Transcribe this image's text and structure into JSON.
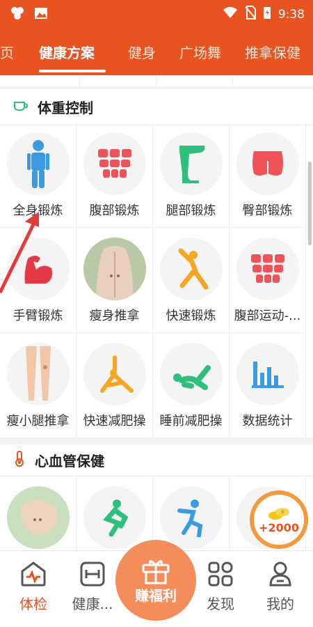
{
  "status_bar": {
    "time": "9:38"
  },
  "tabs": [
    {
      "label": "页",
      "active": false
    },
    {
      "label": "健康方案",
      "active": true
    },
    {
      "label": "健身",
      "active": false
    },
    {
      "label": "广场舞",
      "active": false
    },
    {
      "label": "推拿保健",
      "active": false
    }
  ],
  "weight_section": {
    "title": "体重控制",
    "items": [
      {
        "label": "全身锻炼",
        "icon": "full-body-figure-icon"
      },
      {
        "label": "腹部锻炼",
        "icon": "abs-icon"
      },
      {
        "label": "腿部锻炼",
        "icon": "leg-icon"
      },
      {
        "label": "臀部锻炼",
        "icon": "hip-icon"
      },
      {
        "label": "手臂锻炼",
        "icon": "arm-muscle-icon"
      },
      {
        "label": "瘦身推拿",
        "icon": "back-massage-photo"
      },
      {
        "label": "快速锻炼",
        "icon": "stretch-figure-icon"
      },
      {
        "label": "腹部运动-...",
        "icon": "abs-icon"
      },
      {
        "label": "瘦小腿推拿",
        "icon": "calf-massage-photo"
      },
      {
        "label": "快速减肥操",
        "icon": "yoga-triangle-icon"
      },
      {
        "label": "睡前减肥操",
        "icon": "floor-exercise-icon"
      },
      {
        "label": "数据统计",
        "icon": "bar-chart-icon"
      }
    ]
  },
  "cardio_section": {
    "title": "心血管保健",
    "items": [
      {
        "label": "",
        "icon": "foot-massage-photo"
      },
      {
        "label": "",
        "icon": "kneel-figure-icon"
      },
      {
        "label": "",
        "icon": "squat-figure-icon"
      },
      {
        "label": "",
        "icon": "exercise-icon"
      }
    ]
  },
  "coin_badge": {
    "value": "+2000"
  },
  "bottom_nav": {
    "items": [
      {
        "label": "体检",
        "active": true
      },
      {
        "label": "健康...",
        "active": false
      },
      {
        "label": "赚福利",
        "active": false
      },
      {
        "label": "发现",
        "active": false
      },
      {
        "label": "我的",
        "active": false
      }
    ]
  },
  "colors": {
    "brand": "#e8531f",
    "icon_red": "#f0525a",
    "icon_green": "#2ec07a",
    "icon_orange": "#f5a623",
    "icon_blue": "#3b9be0"
  }
}
